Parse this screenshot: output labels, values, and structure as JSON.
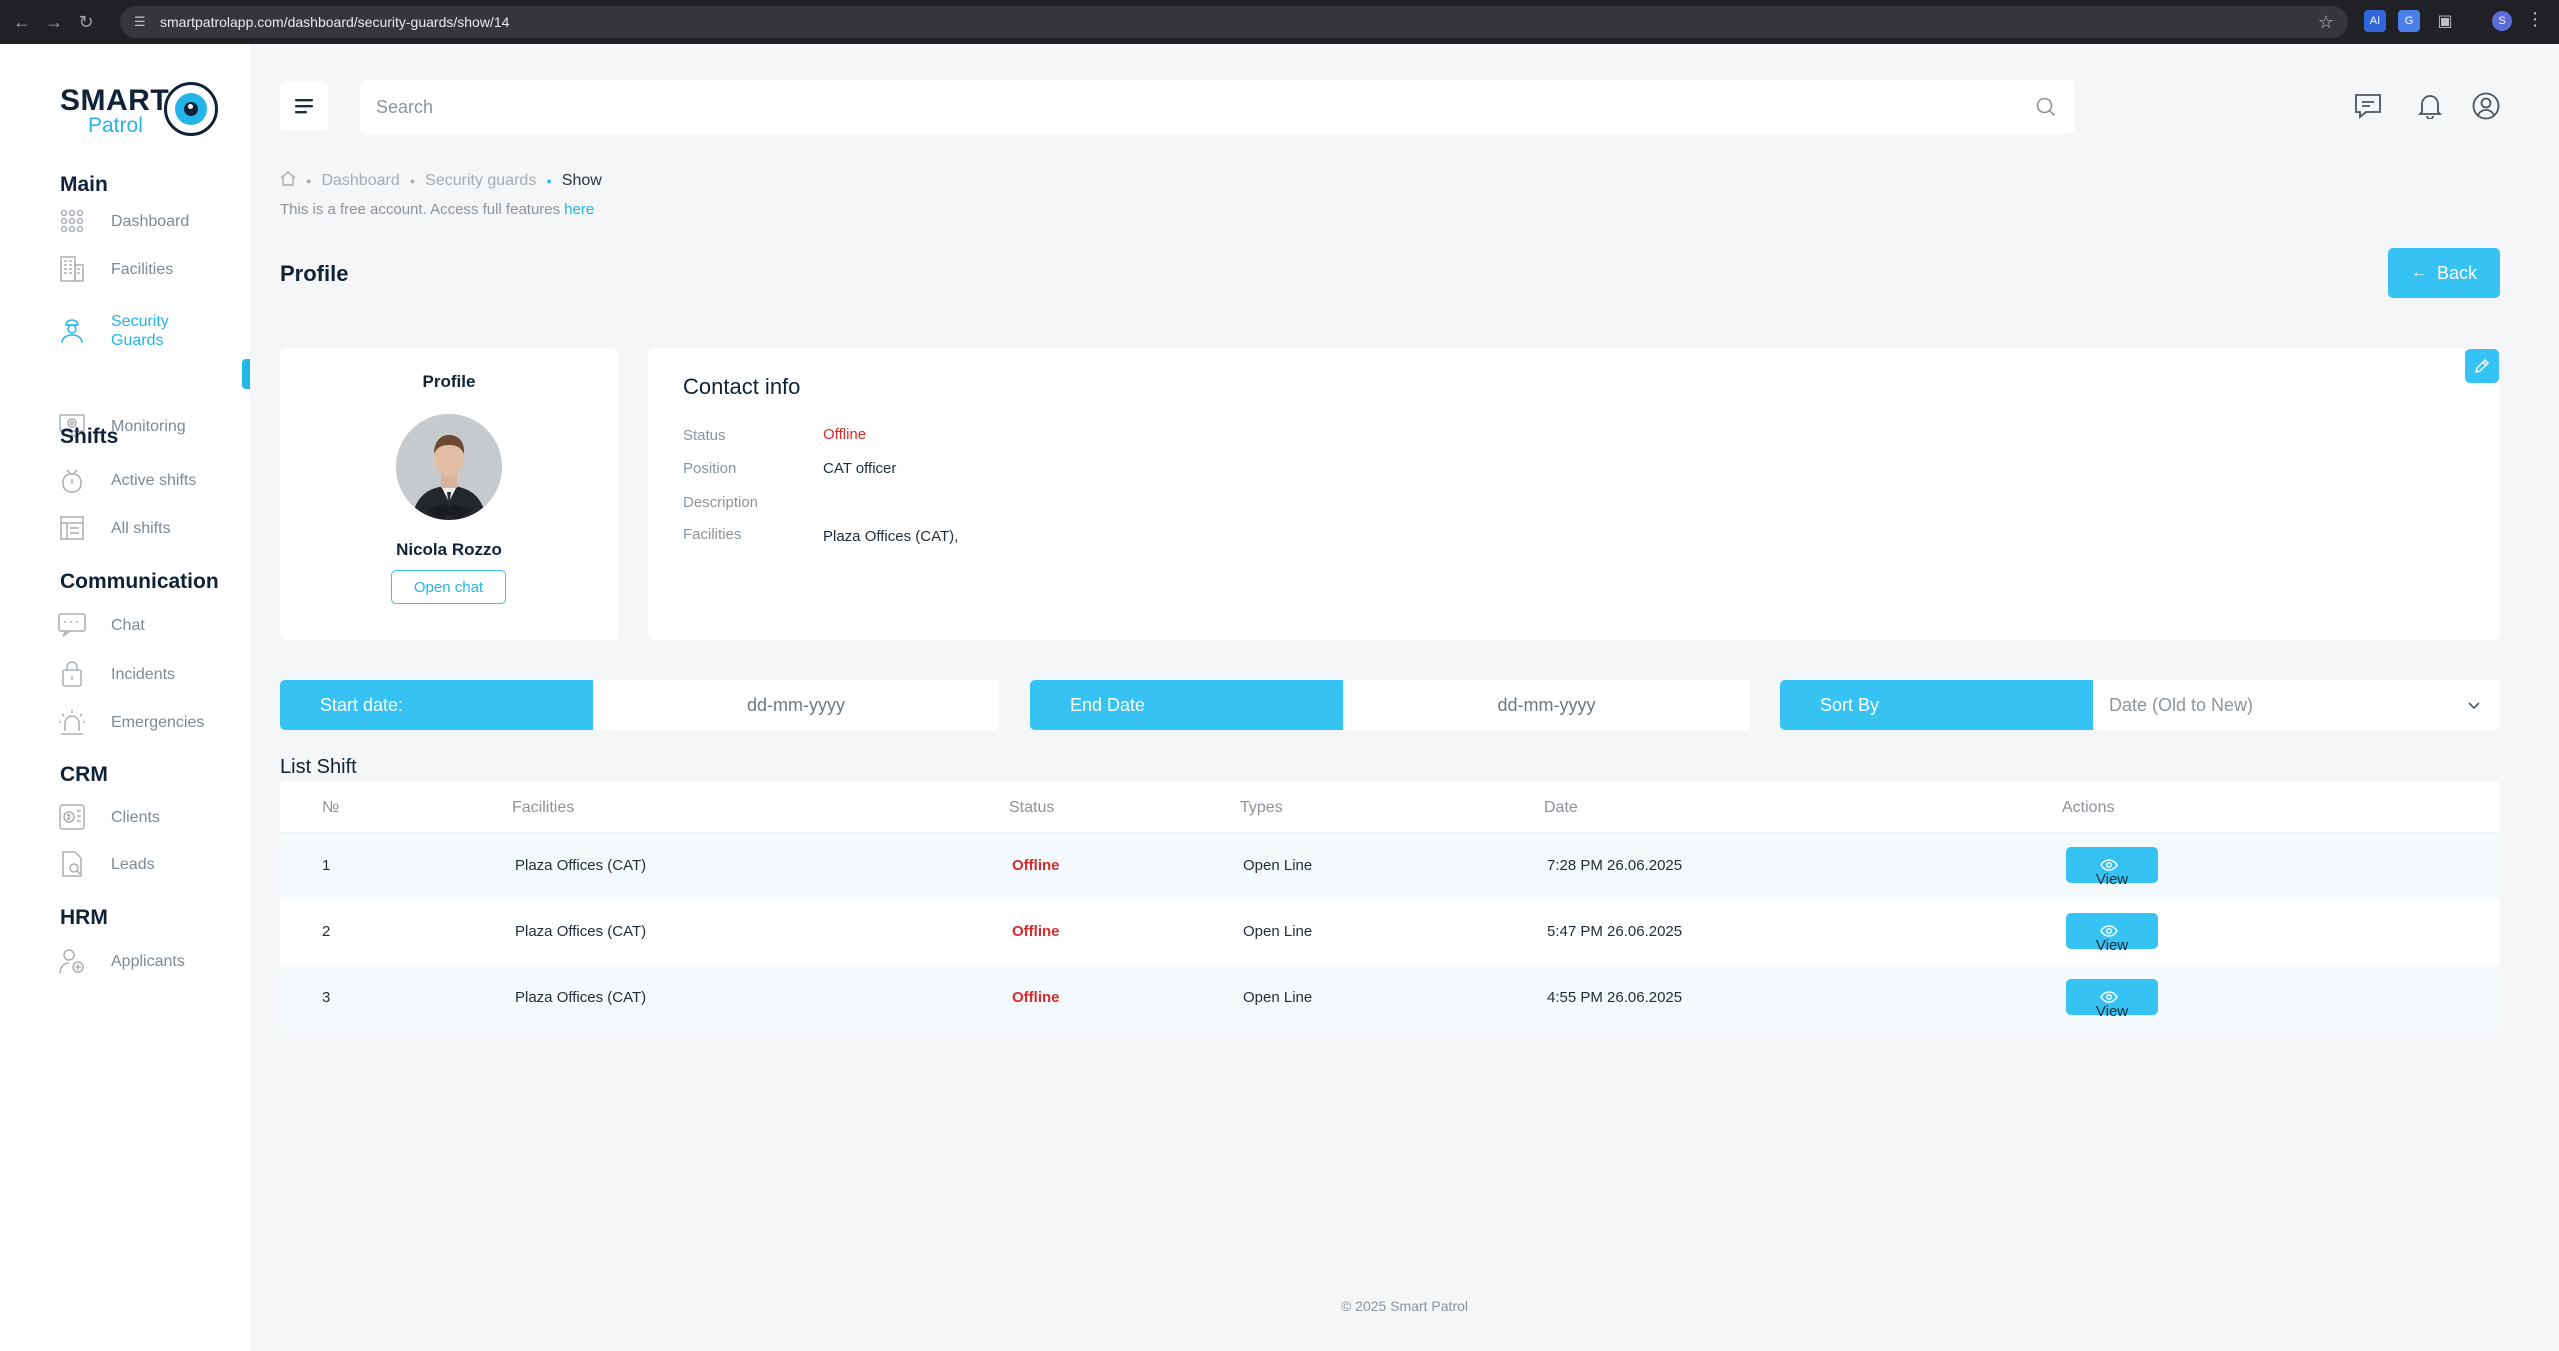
{
  "browser": {
    "url": "smartpatrolapp.com/dashboard/security-guards/show/14",
    "profile_initial": "S"
  },
  "brand": {
    "line1": "SMART",
    "line2": "Patrol",
    "accent": "#23b5e8",
    "dark": "#0f2238"
  },
  "sidebar": {
    "sections": [
      {
        "title": "Main",
        "items": [
          {
            "label": "Dashboard",
            "icon": "grid-icon"
          },
          {
            "label": "Facilities",
            "icon": "building-icon"
          },
          {
            "label": "Security Guards",
            "icon": "guard-icon",
            "active": true
          },
          {
            "label": "Monitoring",
            "icon": "monitor-icon"
          }
        ]
      },
      {
        "title": "Shifts",
        "items": [
          {
            "label": "Active shifts",
            "icon": "shift-icon"
          },
          {
            "label": "All shifts",
            "icon": "list-icon"
          }
        ]
      },
      {
        "title": "Communication",
        "items": [
          {
            "label": "Chat",
            "icon": "chat-icon"
          },
          {
            "label": "Incidents",
            "icon": "incident-icon"
          },
          {
            "label": "Emergencies",
            "icon": "siren-icon"
          }
        ]
      },
      {
        "title": "CRM",
        "items": [
          {
            "label": "Clients",
            "icon": "clients-icon"
          },
          {
            "label": "Leads",
            "icon": "leads-icon"
          }
        ]
      },
      {
        "title": "HRM",
        "items": [
          {
            "label": "Applicants",
            "icon": "applicants-icon"
          }
        ]
      }
    ]
  },
  "search": {
    "placeholder": "Search"
  },
  "breadcrumb": {
    "items": [
      "Dashboard",
      "Security guards"
    ],
    "current": "Show"
  },
  "notice": {
    "text": "This is a free account. Access full features",
    "link": "here"
  },
  "page": {
    "title": "Profile",
    "back_label": "Back"
  },
  "profile": {
    "title": "Profile",
    "name": "Nicola Rozzo",
    "chat_label": "Open chat"
  },
  "contact": {
    "title": "Contact info",
    "rows": [
      {
        "label": "Status",
        "value": "Offline"
      },
      {
        "label": "Position",
        "value": "CAT officer"
      },
      {
        "label": "Description",
        "value": ""
      },
      {
        "label": "Facilities",
        "value": "Plaza Offices (CAT),"
      }
    ]
  },
  "filters": {
    "start": {
      "label": "Start date:",
      "placeholder": "dd-mm-yyyy"
    },
    "end": {
      "label": "End Date",
      "placeholder": "dd-mm-yyyy"
    },
    "sort": {
      "label": "Sort By",
      "value": "Date (Old to New)"
    }
  },
  "shifts": {
    "title": "List Shift",
    "columns": [
      "№",
      "Facilities",
      "Status",
      "Types",
      "Date",
      "Actions"
    ],
    "rows": [
      {
        "no": "1",
        "facility": "Plaza Offices (CAT)",
        "status": "Offline",
        "type": "Open Line",
        "date": "7:28 PM 26.06.2025",
        "action": "View"
      },
      {
        "no": "2",
        "facility": "Plaza Offices (CAT)",
        "status": "Offline",
        "type": "Open Line",
        "date": "5:47 PM 26.06.2025",
        "action": "View"
      },
      {
        "no": "3",
        "facility": "Plaza Offices (CAT)",
        "status": "Offline",
        "type": "Open Line",
        "date": "4:55 PM 26.06.2025",
        "action": "View"
      }
    ]
  },
  "footer": {
    "text": "© 2025 Smart Patrol"
  }
}
